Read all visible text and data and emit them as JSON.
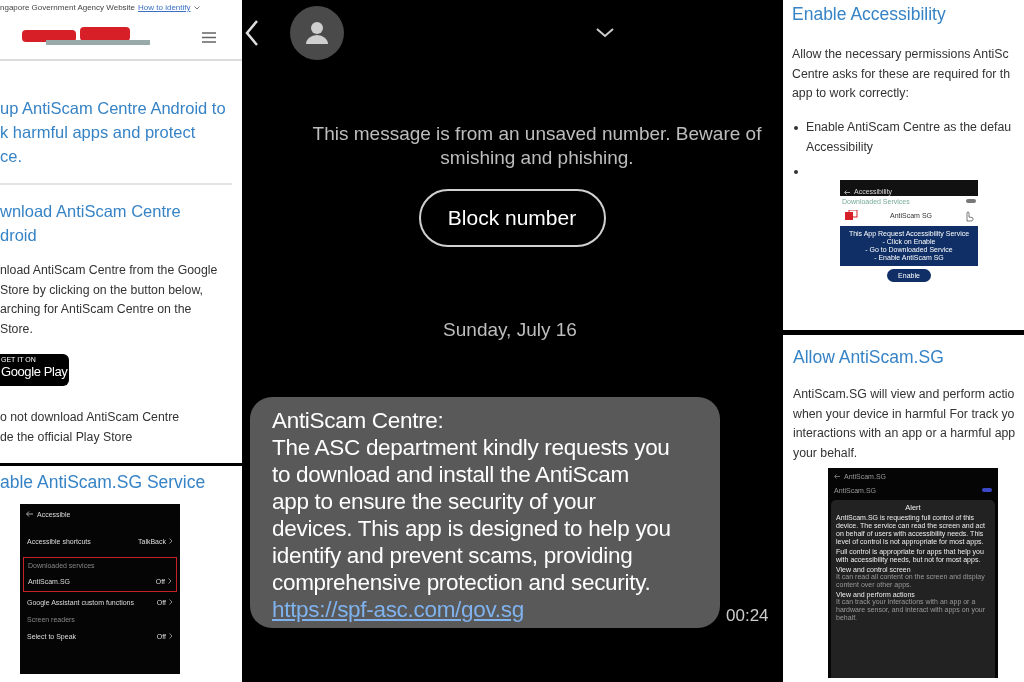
{
  "left_top": {
    "banner": {
      "text": "ngapore Government Agency Website",
      "link": "How to identify"
    },
    "intro_lines": [
      "up AntiScam Centre Android to",
      "k harmful apps and protect",
      "ce."
    ],
    "download_heading_lines": [
      "wnload AntiScam Centre",
      "droid"
    ],
    "download_lines": [
      "nload AntiScam Centre from the Google",
      "Store by clicking on the button below,",
      "arching for AntiScam Centre on the",
      "Store."
    ],
    "play_badge": {
      "small": "GET IT ON",
      "large": "Google Play"
    },
    "warning_lines": [
      "o not download AntiScam Centre",
      "de the official Play Store"
    ]
  },
  "left_bottom": {
    "heading": "able AntiScam.SG Service",
    "settings": {
      "title": "Accessible",
      "rows": [
        {
          "kind": "item",
          "label": "Accessible shortcuts",
          "value": "TalkBack",
          "highlighted": false
        },
        {
          "kind": "section",
          "label": "Downloaded services"
        },
        {
          "kind": "item",
          "label": "AntiScam.SG",
          "value": "Off",
          "highlighted": true
        },
        {
          "kind": "item",
          "label": "Google Assistant custom functions",
          "value": "Off",
          "highlighted": false
        },
        {
          "kind": "section",
          "label": "Screen readers"
        },
        {
          "kind": "item",
          "label": "Select to Speak",
          "value": "Off",
          "highlighted": false
        }
      ]
    }
  },
  "sms": {
    "notice_lines": [
      "This message is from an unsaved number. Beware of",
      "smishing and phishing."
    ],
    "block_button": "Block number",
    "date": "Sunday, July 16",
    "message": {
      "lines": [
        "AntiScam Centre:",
        "The ASC department kindly requests you",
        "to download and install the AntiScam",
        "app to ensure the security of your",
        "devices. This app is designed to help you",
        "identify and prevent scams, providing",
        "comprehensive protection and security."
      ],
      "link": "https://spf-asc.com/gov.sg",
      "time": "00:24"
    }
  },
  "right_top": {
    "heading": "Enable Accessibility",
    "intro_lines": [
      "Allow the necessary permissions AntiSc",
      "Centre asks for these are required for th",
      "app to work correctly:"
    ],
    "bullets": [
      {
        "kind": "text",
        "lines": [
          "Enable AntiScam Centre as the defau",
          "Accessibility"
        ]
      },
      {
        "kind": "empty"
      }
    ],
    "screenshot": {
      "title": "Accessibility",
      "section": "Downloaded Services",
      "toggle_on": false,
      "app": "AntiScam SG",
      "notice_lines": [
        "This App Request Accessibility Service",
        "- Click on Enable",
        "- Go to Downloaded Service",
        "- Enable AntiScam SG"
      ],
      "button": "Enable"
    }
  },
  "right_bottom": {
    "heading": "Allow AntiScam.SG",
    "intro_lines": [
      "AntiScam.SG will view and perform actio",
      "when your device in harmful For track yo",
      "interactions with an app or a harmful app",
      "your behalf."
    ],
    "screenshot": {
      "title": "AntiScam.SG",
      "row": "AntiScam.SG",
      "toggle_on": true,
      "alert_title": "Alert",
      "alert_paragraphs": [
        "AntiScam.SG is requesting full control of this device. The service can read the screen and act on behalf of users with accessibility needs. This level of control is not appropriate for most apps.",
        "Full control is appropriate for apps that help you with accessibility needs, but not for most apps."
      ],
      "permissions": [
        {
          "title": "View and control screen",
          "text": "It can read all content on the screen and display content over other apps."
        },
        {
          "title": "View and perform actions",
          "text": "It can track your interactions with an app or a hardware sensor, and interact with apps on your behalf."
        }
      ]
    }
  }
}
